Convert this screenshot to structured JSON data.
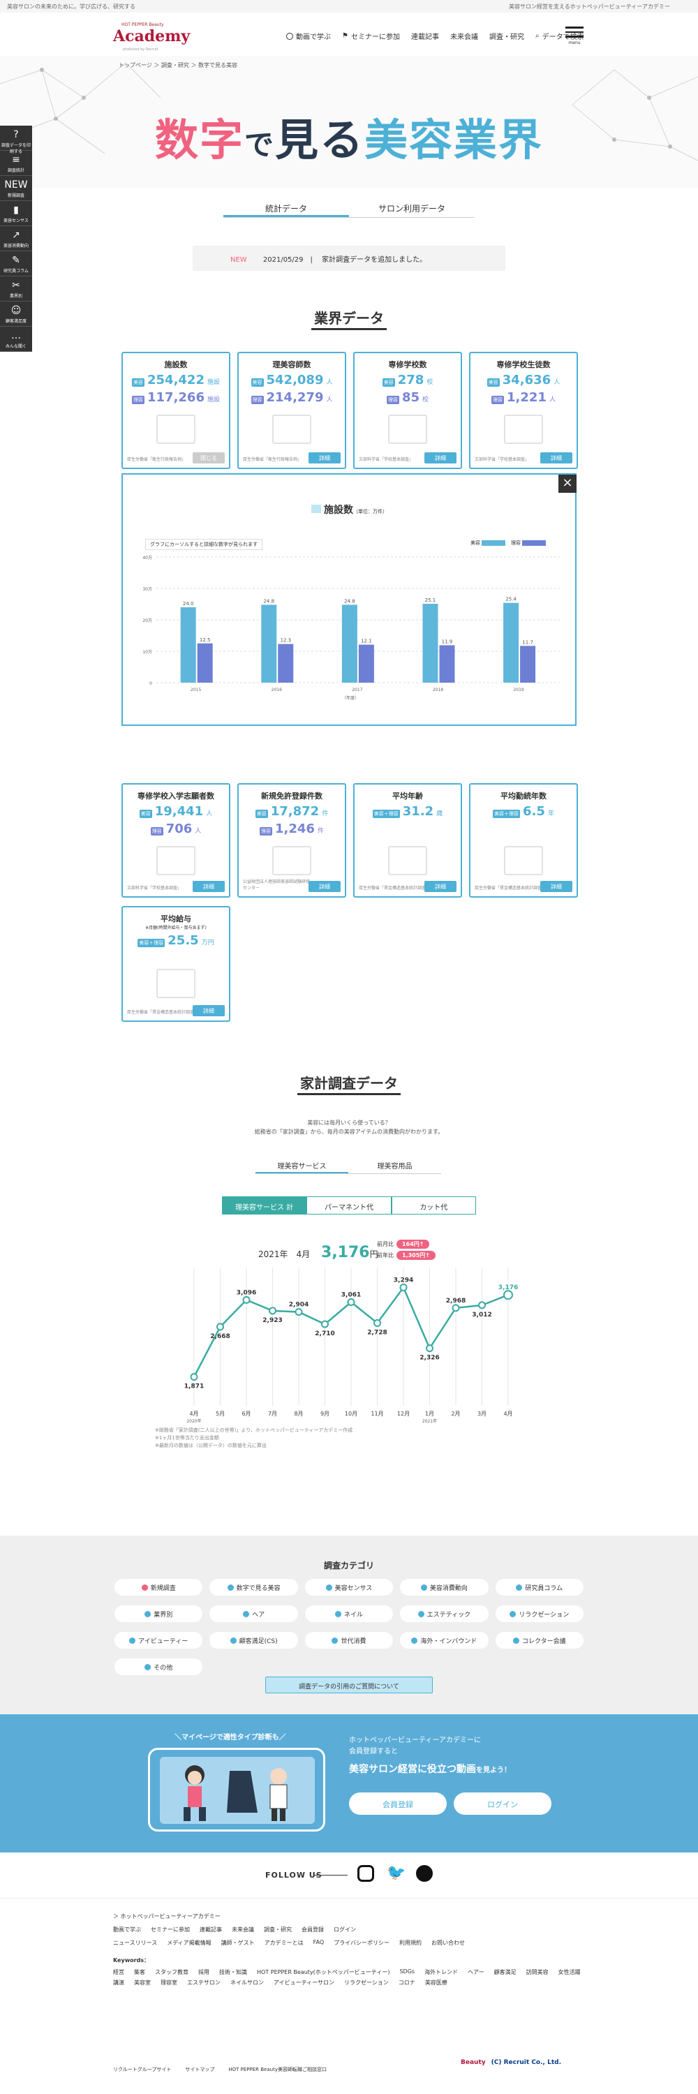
{
  "topbar": {
    "left": "美容サロンの未来のために。学び広げる、研究する",
    "right": "美容サロン経営を支えるホットペッパービューティーアカデミー"
  },
  "logo": {
    "sub": "HOT PEPPER Beauty",
    "main": "Academy",
    "by": "produced by Recruit"
  },
  "nav": [
    {
      "label": "動画で学ぶ",
      "icon": "play-icon"
    },
    {
      "label": "セミナーに参加",
      "icon": "flag-icon"
    },
    {
      "label": "連載記事",
      "icon": ""
    },
    {
      "label": "未来会議",
      "icon": ""
    },
    {
      "label": "調査・研究",
      "icon": ""
    },
    {
      "label": "データで検索",
      "icon": "search-icon"
    }
  ],
  "menu_label": "menu",
  "breadcrumb": [
    "トップページ",
    "調査・研究",
    "数字で見る美容"
  ],
  "hero": {
    "a": "数字",
    "b": "で",
    "c": "見る",
    "d": "美容業界"
  },
  "side": [
    {
      "label": "調査データを印刷する",
      "g": "?"
    },
    {
      "label": "調査統計",
      "g": "≡"
    },
    {
      "label": "新規調査",
      "g": "NEW"
    },
    {
      "label": "美容センサス",
      "g": "▮"
    },
    {
      "label": "美容消費動向",
      "g": "↗"
    },
    {
      "label": "研究員コラム",
      "g": "✎"
    },
    {
      "label": "業界別",
      "g": "✂"
    },
    {
      "label": "顧客満足度",
      "g": "☺"
    },
    {
      "label": "みんな聞く",
      "g": "…"
    }
  ],
  "tabs": [
    "統計データ",
    "サロン利用データ"
  ],
  "news": {
    "tag": "NEW",
    "date": "2021/05/29",
    "text": "家計調査データを追加しました。"
  },
  "section1": "業界データ",
  "cards_top": [
    {
      "title": "施設数",
      "t1": "美容",
      "v1": "254,422",
      "u1": "施設",
      "t2": "理容",
      "v2": "117,266",
      "u2": "施設",
      "src": "厚生労働省「衛生行政報告例」",
      "btn": "閉じる",
      "gray": true
    },
    {
      "title": "理美容師数",
      "t1": "美容",
      "v1": "542,089",
      "u1": "人",
      "t2": "理容",
      "v2": "214,279",
      "u2": "人",
      "src": "厚生労働省「衛生行政報告例」",
      "btn": "詳細",
      "gray": false
    },
    {
      "title": "専修学校数",
      "t1": "美容",
      "v1": "278",
      "u1": "校",
      "t2": "理容",
      "v2": "85",
      "u2": "校",
      "src": "文部科学省「学校基本調査」",
      "btn": "詳細",
      "gray": false
    },
    {
      "title": "専修学校生徒数",
      "t1": "美容",
      "v1": "34,636",
      "u1": "人",
      "t2": "理容",
      "v2": "1,221",
      "u2": "人",
      "src": "文部科学省「学校基本調査」",
      "btn": "詳細",
      "gray": false
    }
  ],
  "chart1": {
    "title": "施設数",
    "unit": "（単位：万件）",
    "hint": "グラフにカーソルすると詳細な数字が見られます",
    "legend": [
      "美容",
      "理容"
    ],
    "colors": {
      "a": "#5fb6db",
      "b": "#6d7fd4"
    },
    "xlabel": "（年度）",
    "chart_data": {
      "type": "bar",
      "categories": [
        "2015",
        "2016",
        "2017",
        "2018",
        "2019"
      ],
      "series": [
        {
          "name": "美容",
          "values": [
            24.0,
            24.8,
            24.8,
            25.1,
            25.4
          ]
        },
        {
          "name": "理容",
          "values": [
            12.5,
            12.3,
            12.1,
            11.9,
            11.7
          ]
        }
      ],
      "yticks": [
        "40万",
        "30万",
        "20万",
        "10万",
        "0"
      ],
      "ylim": [
        0,
        40
      ]
    }
  },
  "cards_mid": [
    {
      "title": "専修学校入学志願者数",
      "t1": "美容",
      "v1": "19,441",
      "u1": "人",
      "t2": "理容",
      "v2": "706",
      "u2": "人",
      "src": "文部科学省「学校基本調査」",
      "btn": "詳細"
    },
    {
      "title": "新規免許登録件数",
      "t1": "美容",
      "v1": "17,872",
      "u1": "件",
      "t2": "理容",
      "v2": "1,246",
      "u2": "件",
      "src": "公益財団法人理容師美容師試験研修センター",
      "btn": "詳細"
    },
    {
      "title": "平均年齢",
      "t1": "美容＋理容",
      "v1": "31.2",
      "u1": "歳",
      "src": "厚生労働省「賃金構造基本統計調査」",
      "btn": "詳細"
    },
    {
      "title": "平均勤続年数",
      "t1": "美容＋理容",
      "v1": "6.5",
      "u1": "年",
      "src": "厚生労働省「賃金構造基本統計調査」",
      "btn": "詳細"
    }
  ],
  "card_salary": {
    "title": "平均給与",
    "sub": "※月額(時間外給与・賞与含まず)",
    "t1": "美容＋理容",
    "v1": "25.5",
    "u1": "万円",
    "src": "厚生労働省「賃金構造基本統計調査」",
    "btn": "詳細"
  },
  "section2": "家計調査データ",
  "kk_desc": [
    "美容には毎月いくら使っている？",
    "総務省の「家計調査」から、毎月の美容アイテムの消費動向がわかります。"
  ],
  "kk_tabs": [
    "理美容サービス",
    "理美容用品"
  ],
  "kk_sub": [
    "理美容サービス 計",
    "パーマネント代",
    "カット代"
  ],
  "kk_date": {
    "label": "2021年　4月",
    "value": "3,176",
    "unit": "円"
  },
  "kk_badges": [
    {
      "label": "前月比",
      "value": "164円↑"
    },
    {
      "label": "前年比",
      "value": "1,305円↑"
    }
  ],
  "chart2": {
    "color": "#3aaba2",
    "chart_data": {
      "type": "line",
      "x": [
        "4月",
        "5月",
        "6月",
        "7月",
        "8月",
        "9月",
        "10月",
        "11月",
        "12月",
        "1月",
        "2月",
        "3月",
        "4月"
      ],
      "year_labels": [
        "2020年",
        "2021年"
      ],
      "values": [
        1871,
        2668,
        3096,
        2923,
        2904,
        2710,
        3061,
        2728,
        3294,
        2326,
        2968,
        3012,
        3176
      ],
      "labels": [
        "1,871",
        "2,668",
        "3,096",
        "2,923",
        "2,904",
        "2,710",
        "3,061",
        "2,728",
        "3,294",
        "2,326",
        "2,968",
        "3,012",
        "3,176"
      ],
      "unit": "円"
    }
  },
  "kk_note": [
    "※総務省「家計調査(二人以上の世帯)」より、ホットペッパービューティーアカデミー作成",
    "※1ヶ月1世帯当たり支出金額",
    "※最新月の数値は（公開データ）の数値を元に算出"
  ],
  "cat_title": "調査カテゴリ",
  "categories": [
    "新規調査",
    "数字で見る美容",
    "美容センサス",
    "美容消費動向",
    "研究員コラム",
    "業界別",
    "ヘア",
    "ネイル",
    "エステティック",
    "リラクゼーション",
    "アイビューティー",
    "顧客満足(CS)",
    "世代消費",
    "海外・インバウンド",
    "コレクター会議",
    "その他"
  ],
  "question_btn": "調査データの引用のご質問について",
  "cta": {
    "bubble": "＼マイページで適性タイプ診断も／",
    "t1": [
      "ホットペッパービューティーアカデミーに",
      "会員登録すると"
    ],
    "t2": "美容サロン経営に役立つ動画",
    "t2b": "を見よう！",
    "b1": "会員登録",
    "b2": "ログイン"
  },
  "follow": "FOLLOW US",
  "footer": {
    "site": "ホットペッパービューティーアカデミー",
    "row1": [
      "動画で学ぶ",
      "セミナーに参加",
      "連載記事",
      "未来会議",
      "調査・研究",
      "会員登録",
      "ログイン"
    ],
    "row2": [
      "ニュースリリース",
      "メディア掲載情報",
      "講師・ゲスト",
      "アカデミーとは",
      "FAQ",
      "プライバシーポリシー",
      "利用規約",
      "お問い合わせ"
    ],
    "kw_label": "Keywords：",
    "keywords": [
      "経営",
      "集客",
      "スタッフ教育",
      "採用",
      "技術・知識",
      "HOT PEPPER Beauty(ホットペッパービューティー)",
      "SDGs",
      "海外トレンド",
      "ヘアー",
      "顧客満足",
      "訪問美容",
      "女性活躍",
      "講演",
      "美容室",
      "理容室",
      "エステサロン",
      "ネイルサロン",
      "アイビューティーサロン",
      "リラクゼーション",
      "コロナ",
      "美容医療"
    ]
  },
  "bottom": [
    "リクルートグループサイト",
    "サイトマップ",
    "HOT PEPPER Beauty美容師転職ご相談窓口"
  ],
  "copyright": "(C) Recruit Co., Ltd."
}
